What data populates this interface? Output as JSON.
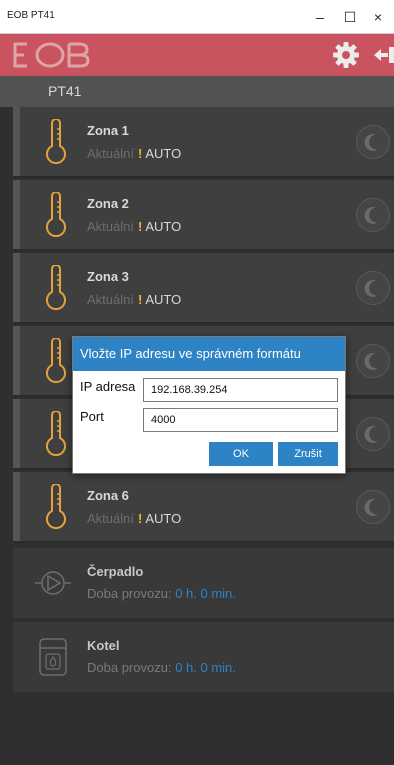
{
  "window": {
    "title": "EOB PT41",
    "minimize": "–",
    "maximize": "☐",
    "close": "×"
  },
  "header": {
    "logo": "EOB",
    "settings_icon": "gear-icon",
    "exit_icon": "exit-icon",
    "brand_color": "#c9535f"
  },
  "device_bar": {
    "name": "PT41"
  },
  "zones": [
    {
      "name": "Zona 1",
      "status_label": "Aktuální",
      "warning": "!",
      "mode": "AUTO"
    },
    {
      "name": "Zona 2",
      "status_label": "Aktuální",
      "warning": "!",
      "mode": "AUTO"
    },
    {
      "name": "Zona 3",
      "status_label": "Aktuální",
      "warning": "!",
      "mode": "AUTO"
    },
    {
      "name": "Zona 6",
      "status_label": "Aktuální",
      "warning": "!",
      "mode": "AUTO"
    }
  ],
  "devices": [
    {
      "name": "Čerpadlo",
      "label": "Doba provozu:",
      "value": "0 h. 0 min.",
      "icon": "pump-icon"
    },
    {
      "name": "Kotel",
      "label": "Doba provozu:",
      "value": "0 h. 0 min.",
      "icon": "boiler-icon"
    }
  ],
  "dialog": {
    "title": "Vložte IP adresu ve správném formátu",
    "ip_label": "IP adresa",
    "ip_value": "192.168.39.254",
    "port_label": "Port",
    "port_value": "4000",
    "ok": "OK",
    "cancel": "Zrušit",
    "accent": "#2e83c5"
  }
}
